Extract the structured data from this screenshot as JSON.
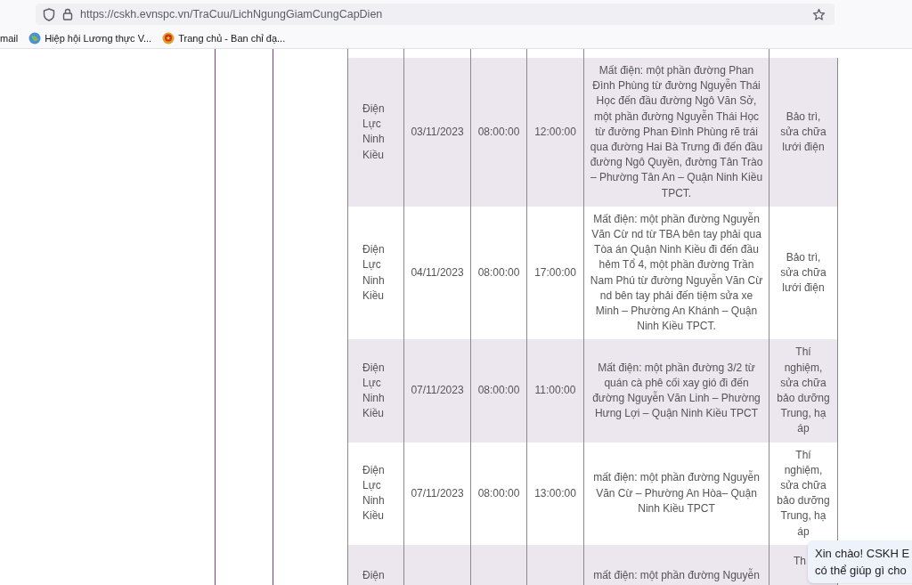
{
  "browser": {
    "url": "https://cskh.evnspc.vn/TraCuu/LichNgungGiamCungCapDien",
    "bookmarks": [
      {
        "kind": "plain",
        "label": "mail"
      },
      {
        "kind": "globe",
        "label": "Hiệp hội Lương thực V..."
      },
      {
        "kind": "emblem",
        "label": "Trang chủ - Ban chỉ đạ..."
      }
    ]
  },
  "table": {
    "rows": [
      {
        "shaded": true,
        "district": "Điện Lực Ninh Kiều",
        "date": "03/11/2023",
        "start": "08:00:00",
        "end": "12:00:00",
        "description": "Mất điện: một phần đường Phan Đình Phùng từ đường Nguyễn Thái Học đến đầu đường Ngô Văn Sở, một phần đường Nguyễn Thái Học từ đường Phan Đình Phùng rẽ trái qua đường Hai Bà Trưng đi đến đầu đường Ngô Quyền, đường Tân Trào – Phường Tân An – Quận Ninh Kiều TPCT.",
        "reason": "Bảo trì, sửa chữa lưới điện"
      },
      {
        "shaded": false,
        "district": "Điện Lực Ninh Kiều",
        "date": "04/11/2023",
        "start": "08:00:00",
        "end": "17:00:00",
        "description": "Mất điện: một phần đường Nguyễn Văn Cừ nd từ TBA bên tay phải qua Tòa án Quận Ninh Kiều đi đến đầu hẻm Tổ 4, một phần đường Trần Nam Phú từ đường Nguyễn Văn Cừ nd bên tay phải đến tiệm sửa xe Minh – Phường An Khánh – Quận Ninh Kiều TPCT.",
        "reason": "Bảo trì, sửa chữa lưới điện"
      },
      {
        "shaded": true,
        "district": "Điện Lực Ninh Kiều",
        "date": "07/11/2023",
        "start": "08:00:00",
        "end": "11:00:00",
        "description": "Mất điện: một phần đường 3/2 từ quán cà phê cối xay gió đi đến đường Nguyễn Văn Linh – Phường Hưng Lợi – Quận Ninh Kiều TPCT",
        "reason": "Thí nghiệm, sửa chữa bảo dưỡng Trung, hạ áp"
      },
      {
        "shaded": false,
        "district": "Điện Lực Ninh Kiều",
        "date": "07/11/2023",
        "start": "08:00:00",
        "end": "13:00:00",
        "description": "mất điện: một phần đường Nguyễn Văn Cừ – Phường An Hòa– Quận Ninh Kiều TPCT",
        "reason": "Thí nghiệm, sửa chữa bảo dưỡng Trung, hạ áp"
      },
      {
        "shaded": true,
        "district": "Điện",
        "description": "mất điện: một phần đường Nguyễn",
        "reason": "Th"
      }
    ]
  },
  "chat_popup": {
    "lines": [
      "Xin chào! CSKH E",
      "có thể giúp gì cho"
    ]
  }
}
